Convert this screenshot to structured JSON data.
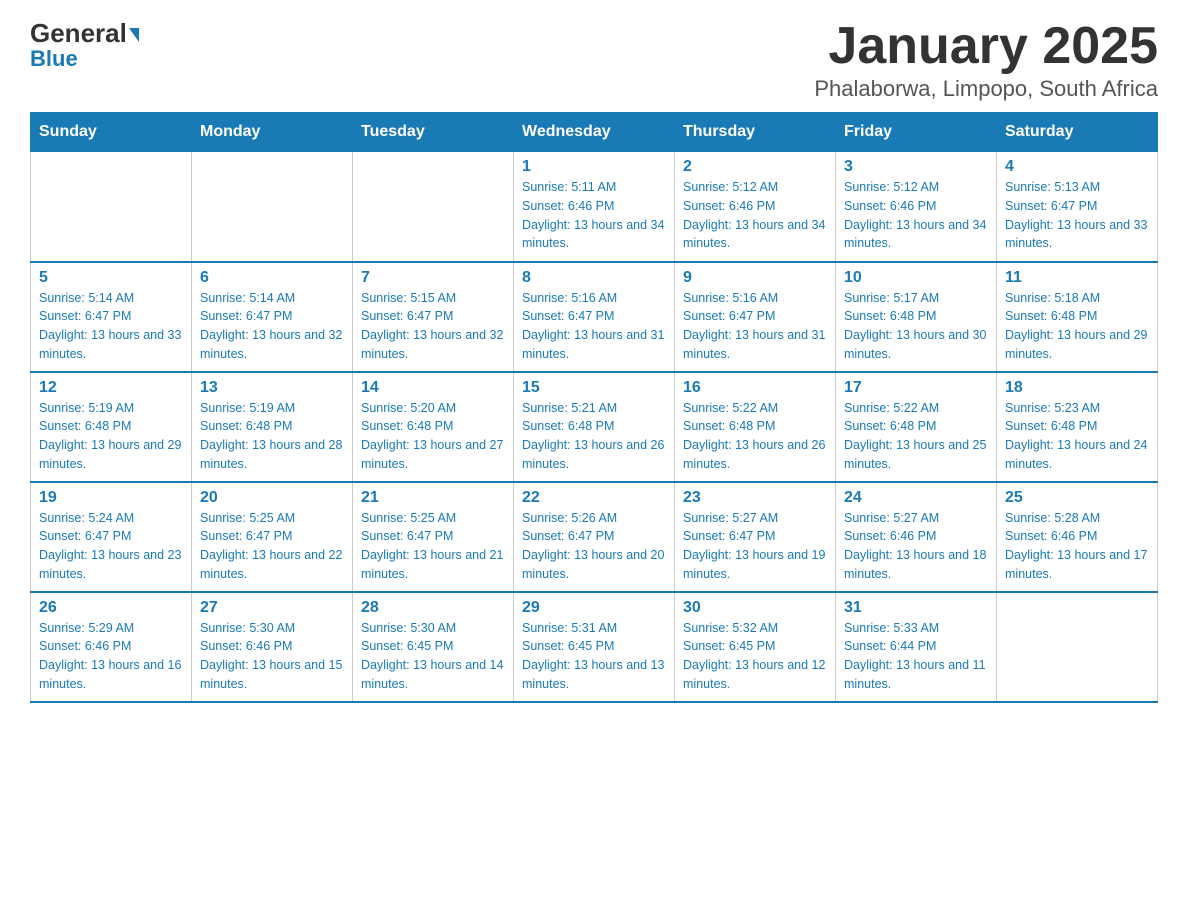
{
  "header": {
    "logo_general": "General",
    "logo_blue": "Blue",
    "month_title": "January 2025",
    "location": "Phalaborwa, Limpopo, South Africa"
  },
  "days_of_week": [
    "Sunday",
    "Monday",
    "Tuesday",
    "Wednesday",
    "Thursday",
    "Friday",
    "Saturday"
  ],
  "weeks": [
    [
      {
        "day": "",
        "info": ""
      },
      {
        "day": "",
        "info": ""
      },
      {
        "day": "",
        "info": ""
      },
      {
        "day": "1",
        "sunrise": "Sunrise: 5:11 AM",
        "sunset": "Sunset: 6:46 PM",
        "daylight": "Daylight: 13 hours and 34 minutes."
      },
      {
        "day": "2",
        "sunrise": "Sunrise: 5:12 AM",
        "sunset": "Sunset: 6:46 PM",
        "daylight": "Daylight: 13 hours and 34 minutes."
      },
      {
        "day": "3",
        "sunrise": "Sunrise: 5:12 AM",
        "sunset": "Sunset: 6:46 PM",
        "daylight": "Daylight: 13 hours and 34 minutes."
      },
      {
        "day": "4",
        "sunrise": "Sunrise: 5:13 AM",
        "sunset": "Sunset: 6:47 PM",
        "daylight": "Daylight: 13 hours and 33 minutes."
      }
    ],
    [
      {
        "day": "5",
        "sunrise": "Sunrise: 5:14 AM",
        "sunset": "Sunset: 6:47 PM",
        "daylight": "Daylight: 13 hours and 33 minutes."
      },
      {
        "day": "6",
        "sunrise": "Sunrise: 5:14 AM",
        "sunset": "Sunset: 6:47 PM",
        "daylight": "Daylight: 13 hours and 32 minutes."
      },
      {
        "day": "7",
        "sunrise": "Sunrise: 5:15 AM",
        "sunset": "Sunset: 6:47 PM",
        "daylight": "Daylight: 13 hours and 32 minutes."
      },
      {
        "day": "8",
        "sunrise": "Sunrise: 5:16 AM",
        "sunset": "Sunset: 6:47 PM",
        "daylight": "Daylight: 13 hours and 31 minutes."
      },
      {
        "day": "9",
        "sunrise": "Sunrise: 5:16 AM",
        "sunset": "Sunset: 6:47 PM",
        "daylight": "Daylight: 13 hours and 31 minutes."
      },
      {
        "day": "10",
        "sunrise": "Sunrise: 5:17 AM",
        "sunset": "Sunset: 6:48 PM",
        "daylight": "Daylight: 13 hours and 30 minutes."
      },
      {
        "day": "11",
        "sunrise": "Sunrise: 5:18 AM",
        "sunset": "Sunset: 6:48 PM",
        "daylight": "Daylight: 13 hours and 29 minutes."
      }
    ],
    [
      {
        "day": "12",
        "sunrise": "Sunrise: 5:19 AM",
        "sunset": "Sunset: 6:48 PM",
        "daylight": "Daylight: 13 hours and 29 minutes."
      },
      {
        "day": "13",
        "sunrise": "Sunrise: 5:19 AM",
        "sunset": "Sunset: 6:48 PM",
        "daylight": "Daylight: 13 hours and 28 minutes."
      },
      {
        "day": "14",
        "sunrise": "Sunrise: 5:20 AM",
        "sunset": "Sunset: 6:48 PM",
        "daylight": "Daylight: 13 hours and 27 minutes."
      },
      {
        "day": "15",
        "sunrise": "Sunrise: 5:21 AM",
        "sunset": "Sunset: 6:48 PM",
        "daylight": "Daylight: 13 hours and 26 minutes."
      },
      {
        "day": "16",
        "sunrise": "Sunrise: 5:22 AM",
        "sunset": "Sunset: 6:48 PM",
        "daylight": "Daylight: 13 hours and 26 minutes."
      },
      {
        "day": "17",
        "sunrise": "Sunrise: 5:22 AM",
        "sunset": "Sunset: 6:48 PM",
        "daylight": "Daylight: 13 hours and 25 minutes."
      },
      {
        "day": "18",
        "sunrise": "Sunrise: 5:23 AM",
        "sunset": "Sunset: 6:48 PM",
        "daylight": "Daylight: 13 hours and 24 minutes."
      }
    ],
    [
      {
        "day": "19",
        "sunrise": "Sunrise: 5:24 AM",
        "sunset": "Sunset: 6:47 PM",
        "daylight": "Daylight: 13 hours and 23 minutes."
      },
      {
        "day": "20",
        "sunrise": "Sunrise: 5:25 AM",
        "sunset": "Sunset: 6:47 PM",
        "daylight": "Daylight: 13 hours and 22 minutes."
      },
      {
        "day": "21",
        "sunrise": "Sunrise: 5:25 AM",
        "sunset": "Sunset: 6:47 PM",
        "daylight": "Daylight: 13 hours and 21 minutes."
      },
      {
        "day": "22",
        "sunrise": "Sunrise: 5:26 AM",
        "sunset": "Sunset: 6:47 PM",
        "daylight": "Daylight: 13 hours and 20 minutes."
      },
      {
        "day": "23",
        "sunrise": "Sunrise: 5:27 AM",
        "sunset": "Sunset: 6:47 PM",
        "daylight": "Daylight: 13 hours and 19 minutes."
      },
      {
        "day": "24",
        "sunrise": "Sunrise: 5:27 AM",
        "sunset": "Sunset: 6:46 PM",
        "daylight": "Daylight: 13 hours and 18 minutes."
      },
      {
        "day": "25",
        "sunrise": "Sunrise: 5:28 AM",
        "sunset": "Sunset: 6:46 PM",
        "daylight": "Daylight: 13 hours and 17 minutes."
      }
    ],
    [
      {
        "day": "26",
        "sunrise": "Sunrise: 5:29 AM",
        "sunset": "Sunset: 6:46 PM",
        "daylight": "Daylight: 13 hours and 16 minutes."
      },
      {
        "day": "27",
        "sunrise": "Sunrise: 5:30 AM",
        "sunset": "Sunset: 6:46 PM",
        "daylight": "Daylight: 13 hours and 15 minutes."
      },
      {
        "day": "28",
        "sunrise": "Sunrise: 5:30 AM",
        "sunset": "Sunset: 6:45 PM",
        "daylight": "Daylight: 13 hours and 14 minutes."
      },
      {
        "day": "29",
        "sunrise": "Sunrise: 5:31 AM",
        "sunset": "Sunset: 6:45 PM",
        "daylight": "Daylight: 13 hours and 13 minutes."
      },
      {
        "day": "30",
        "sunrise": "Sunrise: 5:32 AM",
        "sunset": "Sunset: 6:45 PM",
        "daylight": "Daylight: 13 hours and 12 minutes."
      },
      {
        "day": "31",
        "sunrise": "Sunrise: 5:33 AM",
        "sunset": "Sunset: 6:44 PM",
        "daylight": "Daylight: 13 hours and 11 minutes."
      },
      {
        "day": "",
        "info": ""
      }
    ]
  ]
}
